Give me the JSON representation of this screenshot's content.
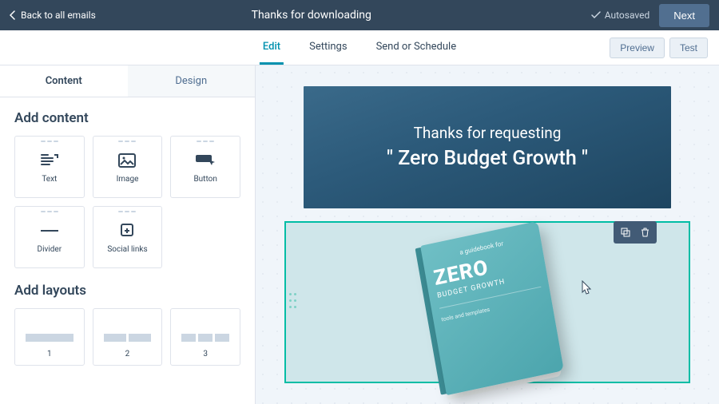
{
  "header": {
    "back_label": "Back to all emails",
    "title": "Thanks for downloading",
    "autosaved_label": "Autosaved",
    "next_label": "Next"
  },
  "subnav": {
    "tabs": [
      {
        "label": "Edit",
        "active": true
      },
      {
        "label": "Settings",
        "active": false
      },
      {
        "label": "Send or Schedule",
        "active": false
      }
    ],
    "preview_label": "Preview",
    "test_label": "Test"
  },
  "sidebar": {
    "tabs": [
      {
        "label": "Content",
        "active": true
      },
      {
        "label": "Design",
        "active": false
      }
    ],
    "add_content_title": "Add content",
    "content_tiles": [
      {
        "label": "Text",
        "icon": "text-icon"
      },
      {
        "label": "Image",
        "icon": "image-icon"
      },
      {
        "label": "Button",
        "icon": "button-icon"
      },
      {
        "label": "Divider",
        "icon": "divider-icon"
      },
      {
        "label": "Social links",
        "icon": "social-links-icon"
      }
    ],
    "add_layouts_title": "Add layouts",
    "layouts": [
      {
        "label": "1",
        "cols": 1
      },
      {
        "label": "2",
        "cols": 2
      },
      {
        "label": "3",
        "cols": 3
      }
    ]
  },
  "canvas": {
    "hero_line1": "Thanks for requesting",
    "hero_line2": "\" Zero Budget Growth \"",
    "book": {
      "tag": "a guidebook for",
      "title": "ZERO",
      "subtitle": "BUDGET GROWTH",
      "footer": "tools and templates"
    }
  }
}
